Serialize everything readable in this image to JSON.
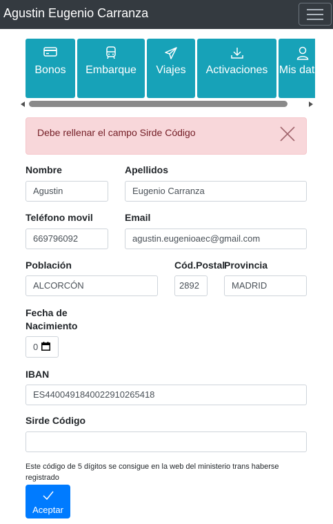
{
  "header": {
    "title": "Agustin Eugenio Carranza",
    "menu_icon": "hamburger-icon"
  },
  "tabs": [
    {
      "label": "Bonos",
      "icon": "credit-card-icon"
    },
    {
      "label": "Embarque",
      "icon": "bus-icon"
    },
    {
      "label": "Viajes",
      "icon": "paper-plane-icon"
    },
    {
      "label": "Activaciones",
      "icon": "download-icon"
    },
    {
      "label": "Mis datos",
      "icon": "user-icon"
    }
  ],
  "alert": {
    "message": "Debe rellenar el campo Sirde Código",
    "close_icon": "close-icon"
  },
  "form": {
    "nombre": {
      "label": "Nombre",
      "value": "Agustin"
    },
    "apellidos": {
      "label": "Apellidos",
      "value": "Eugenio Carranza"
    },
    "telefono": {
      "label": "Teléfono movil",
      "value": "669796092"
    },
    "email": {
      "label": "Email",
      "value": "agustin.eugenioaec@gmail.com"
    },
    "poblacion": {
      "label": "Población",
      "value": "ALCORCÓN"
    },
    "cod_postal": {
      "label": "Cód.Postal",
      "value": "2892"
    },
    "provincia": {
      "label": "Provincia",
      "value": "MADRID"
    },
    "fecha": {
      "label_line1": "Fecha de",
      "label_line2": "Nacimiento",
      "value": "0",
      "icon": "calendar-icon"
    },
    "iban": {
      "label": "IBAN",
      "value": "ES4400491840022910265418"
    },
    "sirde": {
      "label": "Sirde Código",
      "value": ""
    },
    "help_text": "Este código de 5 dígitos se consigue en la web del ministerio trans haberse registrado"
  },
  "submit": {
    "label": "Aceptar",
    "icon": "check-icon"
  },
  "colors": {
    "navbar": "#343a40",
    "tab": "#17a2b8",
    "alert_bg": "#f8d7da",
    "alert_text": "#721c24",
    "primary": "#007bff"
  }
}
